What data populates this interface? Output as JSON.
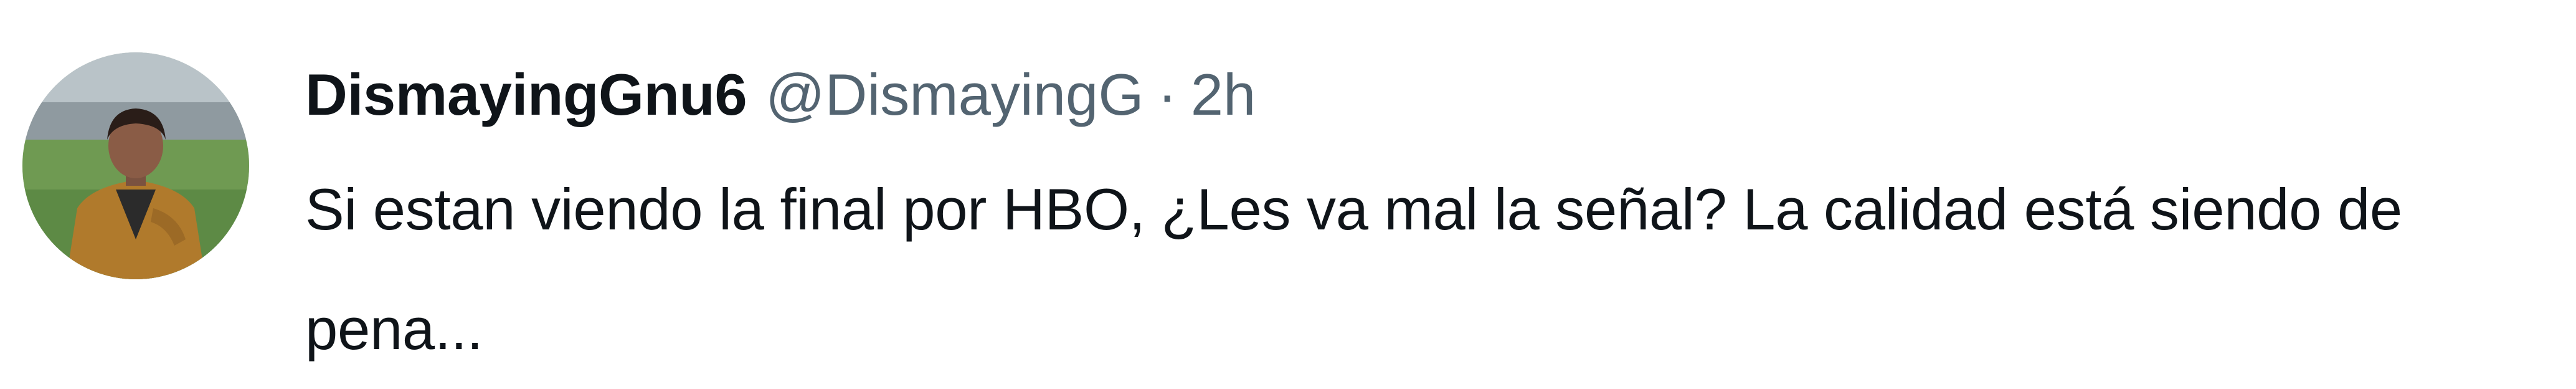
{
  "tweet": {
    "display_name": "DismayingGnu6",
    "handle": "@DismayingG",
    "separator": "·",
    "timestamp": "2h",
    "text": "Si estan viendo la final por HBO, ¿Les va mal la señal? La calidad está siendo de pena..."
  },
  "icons": {
    "avatar": "user-avatar-photo"
  },
  "colors": {
    "name": "#0f1419",
    "secondary": "#536471",
    "background": "#ffffff"
  }
}
